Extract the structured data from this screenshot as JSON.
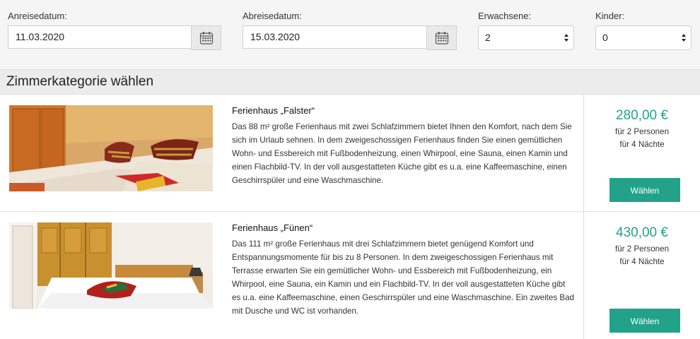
{
  "filters": {
    "arrival": {
      "label": "Anreisedatum:",
      "value": "11.03.2020"
    },
    "departure": {
      "label": "Abreisedatum:",
      "value": "15.03.2020"
    },
    "adults": {
      "label": "Erwachsene:",
      "value": "2"
    },
    "children": {
      "label": "Kinder:",
      "value": "0"
    }
  },
  "section": {
    "title": "Zimmerkategorie wählen"
  },
  "rooms": [
    {
      "name": "Ferienhaus „Falster“",
      "description": "Das 88 m² große Ferienhaus mit zwei Schlafzimmern bietet Ihnen den Komfort, nach dem Sie sich im Urlaub sehnen. In dem zweigeschossigen Ferienhaus finden Sie einen gemütlichen Wohn- und Essbereich mit Fußbodenheizung, einen Whirpool, eine Sauna, einen Kamin und einen Flachbild-TV. In der voll ausgestatteten Küche gibt es u.a. eine Kaffeemaschine, einen Geschirrspüler und eine Waschmaschine.",
      "price": "280,00 €",
      "persons": "für 2 Personen",
      "nights": "für 4 Nächte",
      "button": "Wählen"
    },
    {
      "name": "Ferienhaus „Fünen“",
      "description": "Das 111 m² große Ferienhaus mit drei Schlafzimmern bietet genügend Komfort und Entspannungsmomente für bis zu 8 Personen. In dem zweigeschossigen Ferienhaus mit Terrasse erwarten Sie ein gemütlicher Wohn- und Essbereich mit Fußbodenheizung, ein Whirpool, eine Sauna, ein Kamin und ein Flachbild-TV. In der voll ausgestatteten Küche gibt es u.a. eine Kaffeemaschine, einen Geschirrspüler und eine Waschmaschine. Ein zweites Bad mit Dusche und WC ist vorhanden.",
      "price": "430,00 €",
      "persons": "für 2 Personen",
      "nights": "für 4 Nächte",
      "button": "Wählen"
    }
  ],
  "icons": {
    "calendar": "calendar-icon",
    "select_arrows": "select-arrows-icon"
  },
  "colors": {
    "accent": "#23a28a",
    "filter_bg": "#f5f5f5",
    "section_bg": "#ececec"
  }
}
